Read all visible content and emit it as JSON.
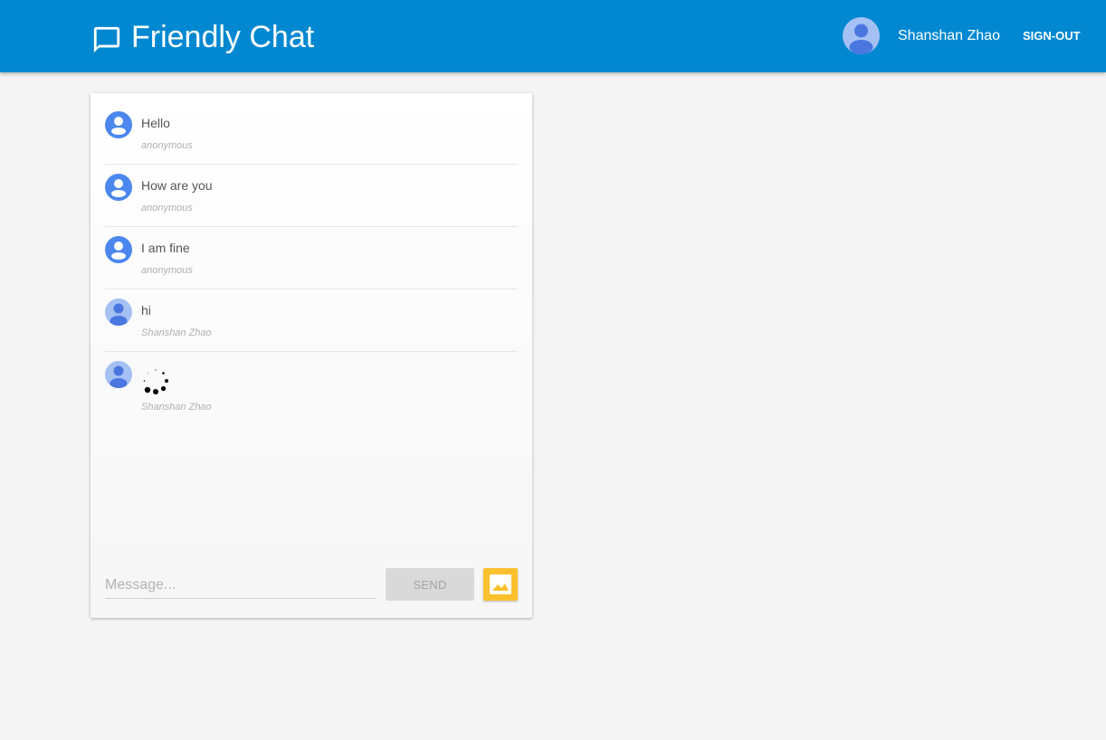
{
  "header": {
    "title": "Friendly Chat",
    "user_name": "Shanshan Zhao",
    "sign_out_label": "SIGN-OUT",
    "brand_color": "#0288d1"
  },
  "messages": [
    {
      "text": "Hello",
      "author": "anonymous",
      "avatar": "anonymous"
    },
    {
      "text": "How are you",
      "author": "anonymous",
      "avatar": "anonymous"
    },
    {
      "text": "I am fine",
      "author": "anonymous",
      "avatar": "anonymous"
    },
    {
      "text": "hi",
      "author": "Shanshan Zhao",
      "avatar": "user"
    },
    {
      "text": "",
      "author": "Shanshan Zhao",
      "avatar": "user",
      "status": "loading"
    }
  ],
  "composer": {
    "placeholder": "Message...",
    "value": "",
    "send_label": "SEND",
    "image_button_icon": "image-icon",
    "image_button_color": "#fbc02d"
  },
  "icons": {
    "brand": "chat-bubble-icon",
    "avatar": "person-icon",
    "loading": "spinner-icon"
  }
}
